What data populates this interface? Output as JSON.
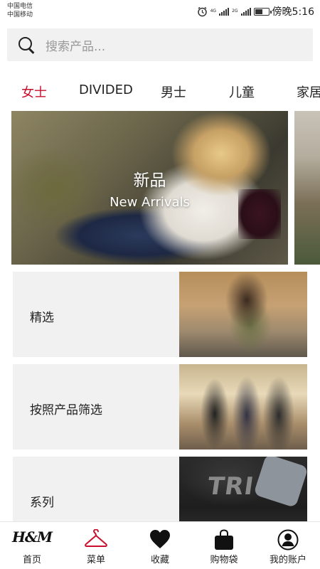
{
  "status_bar": {
    "carrier_1": "中国电信",
    "carrier_2": "中国移动",
    "network_1": "4G",
    "network_2": "2G",
    "time": "傍晚5:16",
    "battery_percent": 60
  },
  "search": {
    "placeholder": "搜索产品..."
  },
  "tabs": [
    {
      "label": "女士",
      "active": true
    },
    {
      "label": "DIVIDED",
      "active": false
    },
    {
      "label": "男士",
      "active": false
    },
    {
      "label": "儿童",
      "active": false
    },
    {
      "label": "家居",
      "active": false
    }
  ],
  "hero": {
    "title": "新品",
    "subtitle": "New Arrivals"
  },
  "cards": [
    {
      "label": "精选"
    },
    {
      "label": "按照产品筛选"
    },
    {
      "label": "系列",
      "image_text": "TRI"
    }
  ],
  "bottom_nav": [
    {
      "label": "首页",
      "icon": "hm-logo",
      "logo_text": "H&M"
    },
    {
      "label": "菜单",
      "icon": "hanger-icon",
      "active": true
    },
    {
      "label": "收藏",
      "icon": "heart-icon"
    },
    {
      "label": "购物袋",
      "icon": "shopping-bag-icon"
    },
    {
      "label": "我的账户",
      "icon": "account-icon"
    }
  ],
  "colors": {
    "accent": "#c8102e",
    "search_bg": "#f1f1f1",
    "card_bg": "#f1f1f1"
  }
}
